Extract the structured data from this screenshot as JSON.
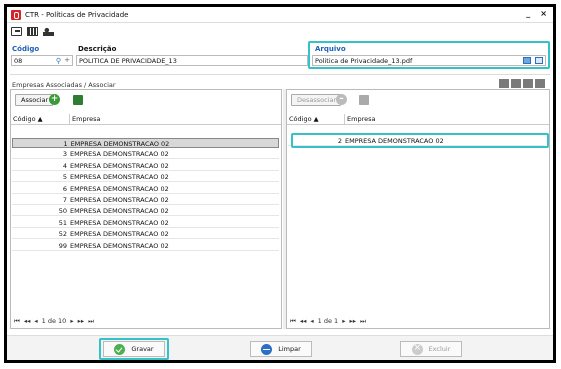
{
  "window": {
    "title": "CTR - Políticas de Privacidade",
    "minimize": "_",
    "close": "×"
  },
  "form": {
    "codigo_label": "Código",
    "codigo_value": "08",
    "descricao_label": "Descrição",
    "descricao_value": "POLITICA DE PRIVACIDADE_13",
    "arquivo_label": "Arquivo",
    "arquivo_value": "Politica de Privacidade_13.pdf"
  },
  "section": {
    "title": "Empresas Associadas / Associar"
  },
  "left_panel": {
    "button_label": "Associar",
    "columns": [
      "Código",
      "Empresa"
    ],
    "rows": [
      {
        "codigo": "1",
        "empresa": "EMPRESA DEMONSTRACAO 02"
      },
      {
        "codigo": "3",
        "empresa": "EMPRESA DEMONSTRACAO 02"
      },
      {
        "codigo": "4",
        "empresa": "EMPRESA DEMONSTRACAO 02"
      },
      {
        "codigo": "5",
        "empresa": "EMPRESA DEMONSTRACAO 02"
      },
      {
        "codigo": "6",
        "empresa": "EMPRESA DEMONSTRACAO 02"
      },
      {
        "codigo": "7",
        "empresa": "EMPRESA DEMONSTRACAO 02"
      },
      {
        "codigo": "50",
        "empresa": "EMPRESA DEMONSTRACAO 02"
      },
      {
        "codigo": "51",
        "empresa": "EMPRESA DEMONSTRACAO 02"
      },
      {
        "codigo": "52",
        "empresa": "EMPRESA DEMONSTRACAO 02"
      },
      {
        "codigo": "99",
        "empresa": "EMPRESA DEMONSTRACAO 02"
      }
    ],
    "pager": "1 de 10"
  },
  "right_panel": {
    "button_label": "Desassociar",
    "columns": [
      "Código",
      "Empresa"
    ],
    "rows": [
      {
        "codigo": "2",
        "empresa": "EMPRESA DEMONSTRACAO 02"
      }
    ],
    "pager": "1 de 1"
  },
  "footer": {
    "save_label": "Gravar",
    "clear_label": "Limpar",
    "delete_label": "Excluir"
  },
  "colors": {
    "highlight": "#33c2c8",
    "label_blue": "#1f5fb8"
  }
}
